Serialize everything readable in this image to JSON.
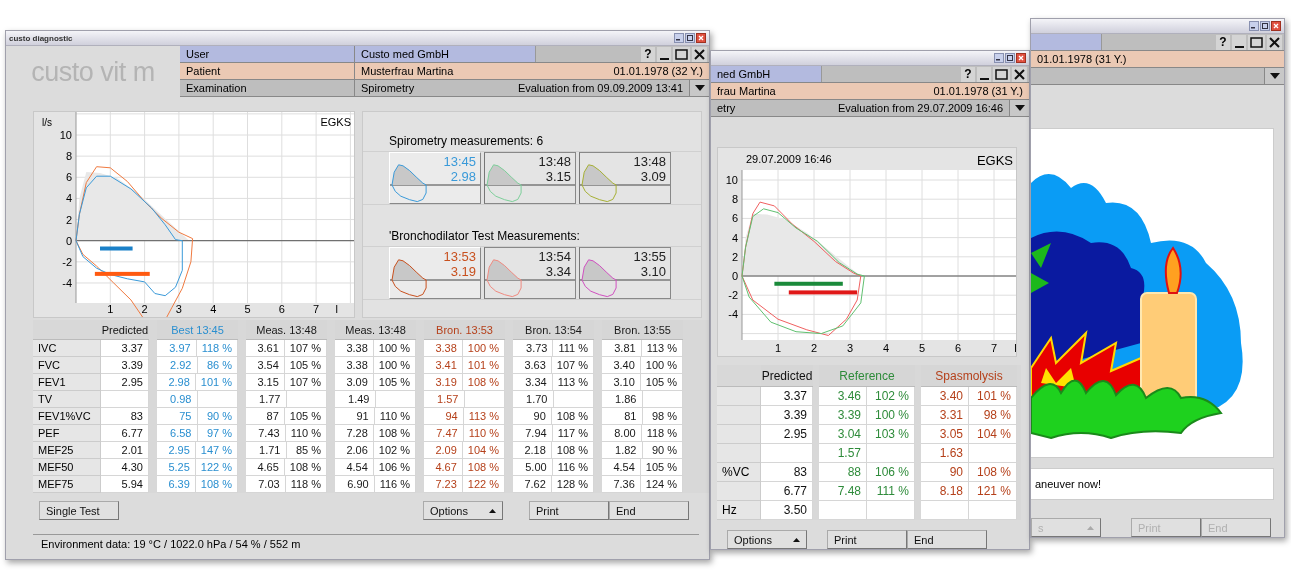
{
  "main_window": {
    "title": "custo diagnostic",
    "logo": "custo vit m",
    "help": "?",
    "header": [
      {
        "kind": "user",
        "label": "User",
        "value": "Custo med GmbH"
      },
      {
        "kind": "patient",
        "label": "Patient",
        "value": "Musterfrau Martina",
        "extra": "01.01.1978 (32 Y.)"
      },
      {
        "kind": "examination",
        "label": "Examination",
        "value": "Spirometry",
        "extra": "Evaluation from 09.09.2009  13:41"
      }
    ],
    "chart": {
      "unit": "l/s",
      "label": "EGKS",
      "y_ticks": [
        "10",
        "8",
        "6",
        "4",
        "2",
        "0",
        "-2",
        "-4"
      ],
      "x_ticks": [
        "1",
        "2",
        "3",
        "4",
        "5",
        "6",
        "7",
        "l"
      ]
    },
    "measurement_groups": [
      {
        "title": "Spirometry measurements: 6",
        "tiles": [
          {
            "time": "13:45",
            "value": "2.98",
            "selected": true,
            "color": "#3a9ad9"
          },
          {
            "time": "13:48",
            "value": "3.15",
            "selected": false,
            "color": "#7dcf9a"
          },
          {
            "time": "13:48",
            "value": "3.09",
            "selected": false,
            "color": "#a6b034"
          }
        ]
      },
      {
        "title": "'Bronchodilator Test Measurements:",
        "tiles": [
          {
            "time": "13:53",
            "value": "3.19",
            "selected": true,
            "color": "#c8501e"
          },
          {
            "time": "13:54",
            "value": "3.34",
            "selected": false,
            "color": "#f08a80"
          },
          {
            "time": "13:55",
            "value": "3.10",
            "selected": false,
            "color": "#d050c0"
          }
        ]
      }
    ],
    "table": {
      "predicted_header": "Predicted",
      "groups": [
        {
          "header": "Best 13:45",
          "color": "#2a8fd0"
        },
        {
          "header": "Meas. 13:48",
          "color": "#1a1a1a"
        },
        {
          "header": "Meas. 13:48",
          "color": "#1a1a1a"
        },
        {
          "header": "Bron. 13:53",
          "color": "#b5401a"
        },
        {
          "header": "Bron. 13:54",
          "color": "#1a1a1a"
        },
        {
          "header": "Bron. 13:55",
          "color": "#1a1a1a"
        }
      ],
      "rows": [
        {
          "label": "IVC",
          "predicted": "3.37",
          "results": [
            {
              "value": "3.97",
              "percent": "118 %"
            },
            {
              "value": "3.61",
              "percent": "107 %"
            },
            {
              "value": "3.38",
              "percent": "100 %"
            },
            {
              "value": "3.38",
              "percent": "100 %"
            },
            {
              "value": "3.73",
              "percent": "111 %"
            },
            {
              "value": "3.81",
              "percent": "113 %"
            }
          ]
        },
        {
          "label": "FVC",
          "predicted": "3.39",
          "results": [
            {
              "value": "2.92",
              "percent": "86 %"
            },
            {
              "value": "3.54",
              "percent": "105 %"
            },
            {
              "value": "3.38",
              "percent": "100 %"
            },
            {
              "value": "3.41",
              "percent": "101 %"
            },
            {
              "value": "3.63",
              "percent": "107 %"
            },
            {
              "value": "3.40",
              "percent": "100 %"
            }
          ]
        },
        {
          "label": "FEV1",
          "predicted": "2.95",
          "results": [
            {
              "value": "2.98",
              "percent": "101 %"
            },
            {
              "value": "3.15",
              "percent": "107 %"
            },
            {
              "value": "3.09",
              "percent": "105 %"
            },
            {
              "value": "3.19",
              "percent": "108 %"
            },
            {
              "value": "3.34",
              "percent": "113 %"
            },
            {
              "value": "3.10",
              "percent": "105 %"
            }
          ]
        },
        {
          "label": "TV",
          "results": [
            {
              "value": "0.98"
            },
            {
              "value": "1.77"
            },
            {
              "value": "1.49"
            },
            {
              "value": "1.57"
            },
            {
              "value": "1.70"
            },
            {
              "value": "1.86"
            }
          ]
        },
        {
          "label": "FEV1%VC",
          "predicted": "83",
          "results": [
            {
              "value": "75",
              "percent": "90 %"
            },
            {
              "value": "87",
              "percent": "105 %"
            },
            {
              "value": "91",
              "percent": "110 %"
            },
            {
              "value": "94",
              "percent": "113 %"
            },
            {
              "value": "90",
              "percent": "108 %"
            },
            {
              "value": "81",
              "percent": "98 %"
            }
          ]
        },
        {
          "label": "PEF",
          "predicted": "6.77",
          "results": [
            {
              "value": "6.58",
              "percent": "97 %"
            },
            {
              "value": "7.43",
              "percent": "110 %"
            },
            {
              "value": "7.28",
              "percent": "108 %"
            },
            {
              "value": "7.47",
              "percent": "110 %"
            },
            {
              "value": "7.94",
              "percent": "117 %"
            },
            {
              "value": "8.00",
              "percent": "118 %"
            }
          ]
        },
        {
          "label": "MEF25",
          "predicted": "2.01",
          "results": [
            {
              "value": "2.95",
              "percent": "147 %"
            },
            {
              "value": "1.71",
              "percent": "85 %"
            },
            {
              "value": "2.06",
              "percent": "102 %"
            },
            {
              "value": "2.09",
              "percent": "104 %"
            },
            {
              "value": "2.18",
              "percent": "108 %"
            },
            {
              "value": "1.82",
              "percent": "90 %"
            }
          ]
        },
        {
          "label": "MEF50",
          "predicted": "4.30",
          "results": [
            {
              "value": "5.25",
              "percent": "122 %"
            },
            {
              "value": "4.65",
              "percent": "108 %"
            },
            {
              "value": "4.54",
              "percent": "106 %"
            },
            {
              "value": "4.67",
              "percent": "108 %"
            },
            {
              "value": "5.00",
              "percent": "116 %"
            },
            {
              "value": "4.54",
              "percent": "105 %"
            }
          ]
        },
        {
          "label": "MEF75",
          "predicted": "5.94",
          "results": [
            {
              "value": "6.39",
              "percent": "108 %"
            },
            {
              "value": "7.03",
              "percent": "118 %"
            },
            {
              "value": "6.90",
              "percent": "116 %"
            },
            {
              "value": "7.23",
              "percent": "122 %"
            },
            {
              "value": "7.62",
              "percent": "128 %"
            },
            {
              "value": "7.36",
              "percent": "124 %"
            }
          ]
        }
      ]
    },
    "buttons": [
      {
        "label": "Single Test",
        "kind": "plain",
        "disabled": false
      },
      {
        "label": "Options",
        "kind": "menu",
        "disabled": false
      },
      {
        "label": "Print",
        "kind": "pair",
        "disabled": false
      },
      {
        "label": "End",
        "kind": "pair",
        "disabled": false
      }
    ],
    "status": "Environment data: 19 °C / 1022.0 hPa / 54 % / 552 m"
  },
  "second_window": {
    "help": "?",
    "header": [
      {
        "kind": "user",
        "value": "ned GmbH"
      },
      {
        "kind": "patient",
        "value": "frau Martina",
        "extra": "01.01.1978 (31 Y.)"
      },
      {
        "kind": "examination",
        "value": "etry",
        "extra": "Evaluation from 29.07.2009  16:46"
      }
    ],
    "chart": {
      "date": "29.07.2009 16:46",
      "label": "EGKS",
      "y_ticks": [
        "10",
        "8",
        "6",
        "4",
        "2",
        "0",
        "-2",
        "-4"
      ],
      "x_ticks": [
        "1",
        "2",
        "3",
        "4",
        "5",
        "6",
        "7",
        "l"
      ]
    },
    "table": {
      "predicted_header": "Predicted",
      "groups": [
        {
          "header": "Reference",
          "color": "#2e8b3a"
        },
        {
          "header": "Spasmolysis",
          "color": "#b5401a"
        }
      ],
      "rows": [
        {
          "predicted": "3.37",
          "results": [
            {
              "value": "3.46",
              "percent": "102 %"
            },
            {
              "value": "3.40",
              "percent": "101 %"
            }
          ]
        },
        {
          "predicted": "3.39",
          "results": [
            {
              "value": "3.39",
              "percent": "100 %"
            },
            {
              "value": "3.31",
              "percent": "98 %"
            }
          ]
        },
        {
          "predicted": "2.95",
          "results": [
            {
              "value": "3.04",
              "percent": "103 %"
            },
            {
              "value": "3.05",
              "percent": "104 %"
            }
          ]
        },
        {
          "results": [
            {
              "value": "1.57"
            },
            {
              "value": "1.63"
            }
          ]
        },
        {
          "label": "%VC",
          "predicted": "83",
          "results": [
            {
              "value": "88",
              "percent": "106 %"
            },
            {
              "value": "90",
              "percent": "108 %"
            }
          ]
        },
        {
          "predicted": "6.77",
          "results": [
            {
              "value": "7.48",
              "percent": "111 %"
            },
            {
              "value": "8.18",
              "percent": "121 %"
            }
          ]
        },
        {
          "label": "Hz",
          "predicted": "3.50"
        }
      ]
    },
    "buttons": [
      {
        "label": "Options",
        "kind": "menu",
        "disabled": false
      },
      {
        "label": "Print",
        "kind": "pair",
        "disabled": false
      },
      {
        "label": "End",
        "kind": "pair",
        "disabled": false
      }
    ]
  },
  "third_window": {
    "help": "?",
    "header": [
      {
        "kind": "user"
      },
      {
        "kind": "patient",
        "extra": "01.01.1978 (31 Y.)"
      },
      {
        "kind": "examination"
      }
    ],
    "message": "aneuver now!",
    "buttons": [
      {
        "label": "s",
        "kind": "menu",
        "disabled": true
      },
      {
        "label": "Print",
        "kind": "pair",
        "disabled": true
      },
      {
        "label": "End",
        "kind": "pair",
        "disabled": true
      }
    ]
  }
}
